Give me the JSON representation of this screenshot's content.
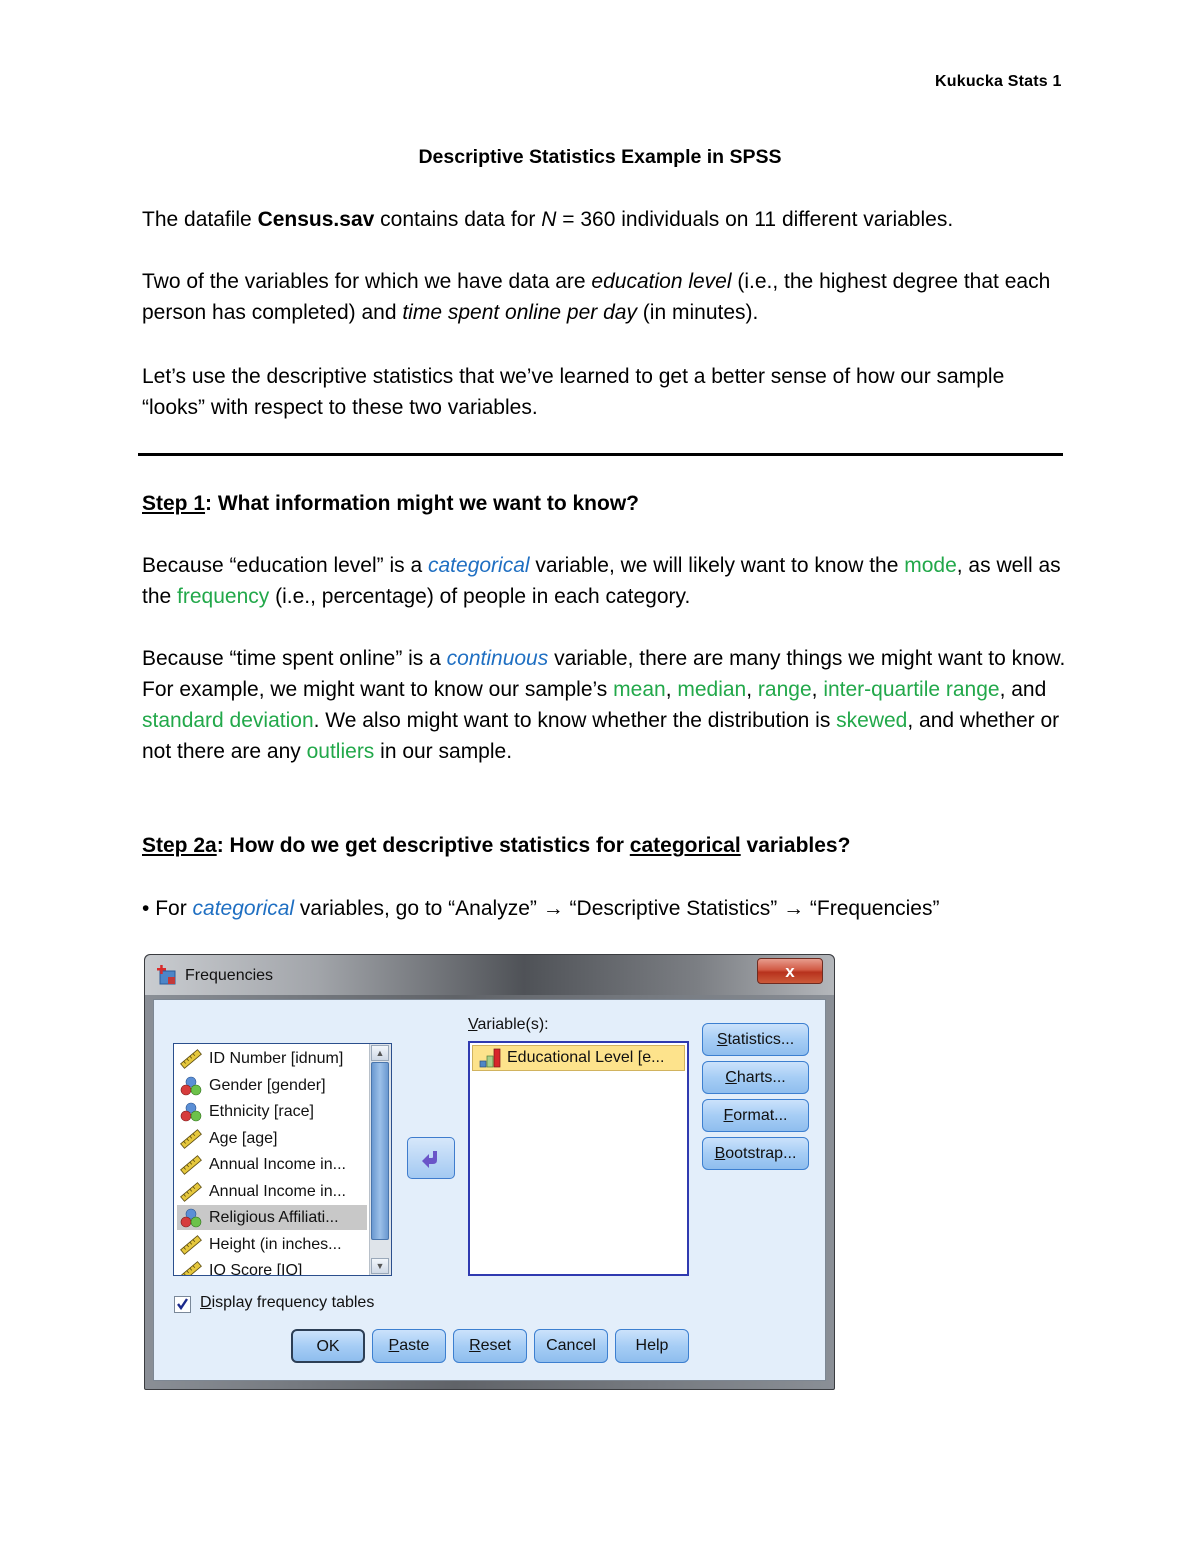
{
  "header": {
    "running_head": "Kukucka Stats 1"
  },
  "document": {
    "title": "Descriptive Statistics Example in SPSS",
    "intro": {
      "t1": "The datafile ",
      "file": "Census.sav",
      "t2": " contains data for ",
      "n_symbol": "N",
      "t3": " = 360 individuals on 11 different variables."
    },
    "para2": {
      "t1": "Two of the variables for which we have data are ",
      "var1": "education level",
      "t2": " (i.e., the highest degree that each person has completed) and ",
      "var2": "time spent online per day",
      "t3": " (in minutes)."
    },
    "para3": "Let’s use the descriptive statistics that we’ve learned to get a better sense of how our sample “looks” with respect to these two variables.",
    "step1": {
      "label": "Step 1",
      "rest": ": What information might we want to know?"
    },
    "step1_p1": {
      "t1": "Because “education level” is a ",
      "type": "categorical",
      "t2": " variable, we will likely want to know the ",
      "g1": "mode",
      "t3": ", as well as the ",
      "g2": "frequency",
      "t4": " (i.e., percentage) of people in each category."
    },
    "step1_p2": {
      "t1": "Because “time spent online” is a ",
      "type": "continuous",
      "t2": " variable, there are many things we might want to know. For example, we might want to know our sample’s ",
      "g1": "mean",
      "s1": ", ",
      "g2": "median",
      "s2": ", ",
      "g3": "range",
      "s3": ", ",
      "g4": "inter-quartile range",
      "s4": ", and ",
      "g5": "standard deviation",
      "s5": ". We also might want to know whether the distribution is ",
      "g6": "skewed",
      "s6": ", and whether or not there are any ",
      "g7": "outliers",
      "s7": " in our sample."
    },
    "step2a": {
      "label": "Step 2a",
      "t1": ": How do we get descriptive statistics for ",
      "emph": "categorical",
      "t2": " variables?"
    },
    "bullet": {
      "mark": "•",
      "t1": " For ",
      "type": "categorical",
      "t2": " variables, go to “Analyze” ",
      "arrow": "→",
      "t3": " “Descriptive Statistics” ",
      "t4": " “Frequencies”"
    }
  },
  "dialog": {
    "title": "Frequencies",
    "close_label": "x",
    "source_list": [
      {
        "label": "ID Number [idnum]",
        "icon": "scale-ruler-icon",
        "selected": false
      },
      {
        "label": "Gender [gender]",
        "icon": "nominal-circles-icon",
        "selected": false
      },
      {
        "label": "Ethnicity [race]",
        "icon": "nominal-circles-icon",
        "selected": false
      },
      {
        "label": "Age [age]",
        "icon": "scale-ruler-icon",
        "selected": false
      },
      {
        "label": "Annual Income in...",
        "icon": "scale-ruler-icon",
        "selected": false
      },
      {
        "label": "Annual Income in...",
        "icon": "scale-ruler-icon",
        "selected": false
      },
      {
        "label": "Religious Affiliati...",
        "icon": "nominal-circles-icon",
        "selected": true
      },
      {
        "label": "Height (in inches...",
        "icon": "scale-ruler-icon",
        "selected": false
      },
      {
        "label": "IQ Score [IQ]",
        "icon": "scale-ruler-icon",
        "selected": false
      }
    ],
    "variables_label": "Variable(s):",
    "target_list": [
      {
        "label": "Educational Level [e...",
        "icon": "ordinal-bars-icon"
      }
    ],
    "side_buttons": [
      "Statistics...",
      "Charts...",
      "Format...",
      "Bootstrap..."
    ],
    "checkbox": {
      "label": "Display frequency tables",
      "checked": true
    },
    "bottom_buttons": [
      "OK",
      "Paste",
      "Reset",
      "Cancel",
      "Help"
    ]
  }
}
